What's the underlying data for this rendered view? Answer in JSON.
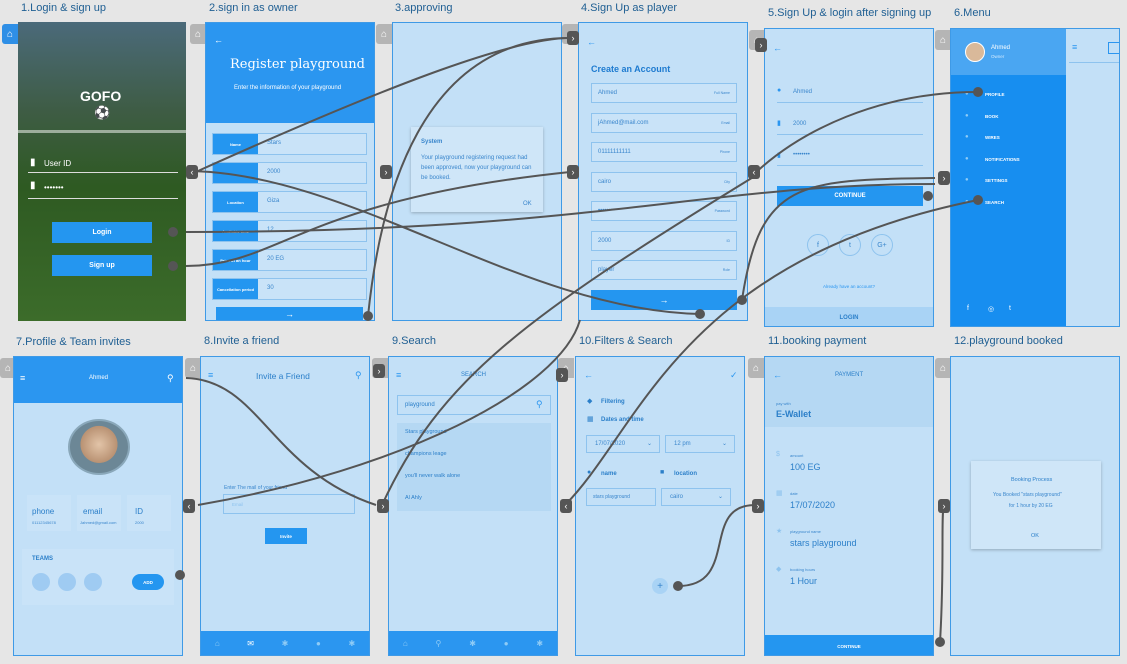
{
  "labels": [
    "1.Login & sign up",
    "2.sign in as owner",
    "3.approving",
    "4.Sign Up as player",
    "5.Sign Up & login after signing up",
    "6.Menu",
    "7.Profile & Team invites",
    "8.Invite a friend",
    "9.Search",
    "10.Filters & Search",
    "11.booking payment",
    "12.playground booked"
  ],
  "s1": {
    "logo": "GOFO",
    "user_id": "User ID",
    "password": "•••••••",
    "login": "Login",
    "signup": "Sign up"
  },
  "s2": {
    "title": "Register playground",
    "subtitle": "Enter the information of your playground",
    "rows": [
      [
        "Name",
        "Stars"
      ],
      [
        "",
        "2000"
      ],
      [
        "Location",
        "Giza"
      ],
      [
        "Available time",
        "12"
      ],
      [
        "Price of an hour",
        "20 EG"
      ],
      [
        "Cancellation period",
        "30"
      ]
    ]
  },
  "s3": {
    "title": "System",
    "body": "Your playground registering request had been approved, now your playground can be booked.",
    "ok": "OK"
  },
  "s4": {
    "title": "Create an Account",
    "fields": [
      [
        "Ahmed",
        "Full Name"
      ],
      [
        "jAhmed@mail.com",
        "Email"
      ],
      [
        "01111111111",
        "Phone"
      ],
      [
        "cairo",
        "City"
      ],
      [
        "••••••••",
        "Password"
      ],
      [
        "2000",
        "ID"
      ],
      [
        "player",
        "Role"
      ]
    ]
  },
  "s5": {
    "name": "Ahmed",
    "id": "2000",
    "pass": "••••••••",
    "continue": "CONTINUE",
    "already": "Already have an account?",
    "login": "LOGIN"
  },
  "s6": {
    "name": "Ahmed",
    "role": "Owner",
    "items": [
      "PROFILE",
      "BOOK",
      "WIRES",
      "NOTIFICATIONS",
      "SETTINGS",
      "SEARCH"
    ]
  },
  "s7": {
    "title": "Ahmed",
    "phone": "phone",
    "phone_val": "01112345678",
    "email": "email",
    "email_val": "Jahmed@gmail.com",
    "id": "ID",
    "id_val": "2000",
    "teams": "TEAMS",
    "add": "ADD"
  },
  "s8": {
    "title": "Invite a Friend",
    "prompt": "Enter The mail of your friend",
    "placeholder": "Email",
    "invite": "Invite"
  },
  "s9": {
    "title": "SEARCH",
    "query": "playground",
    "results": [
      "Stars playground",
      "champions leage",
      "you'll never walk alone",
      "Al Ahly"
    ]
  },
  "s10": {
    "filtering": "Filtering",
    "date_time": "Dates and time",
    "date": "17/07/2020",
    "time": "12 pm",
    "name": "name",
    "location": "location",
    "name_val": "stars playground",
    "loc_val": "cairo"
  },
  "s11": {
    "title": "PAYMENT",
    "pay_label": "pay with",
    "wallet": "E-Wallet",
    "amount_label": "amount",
    "amount": "100 EG",
    "date_label": "date",
    "date": "17/07/2020",
    "pg_label": "playground name",
    "pg": "stars playground",
    "hours_label": "booking hours",
    "hours": "1 Hour",
    "continue": "CONTINUE"
  },
  "s12": {
    "title": "Booking Process",
    "body1": "You Booked \"stars playground\"",
    "body2": "for 1 hour by 20 EG",
    "ok": "OK"
  }
}
